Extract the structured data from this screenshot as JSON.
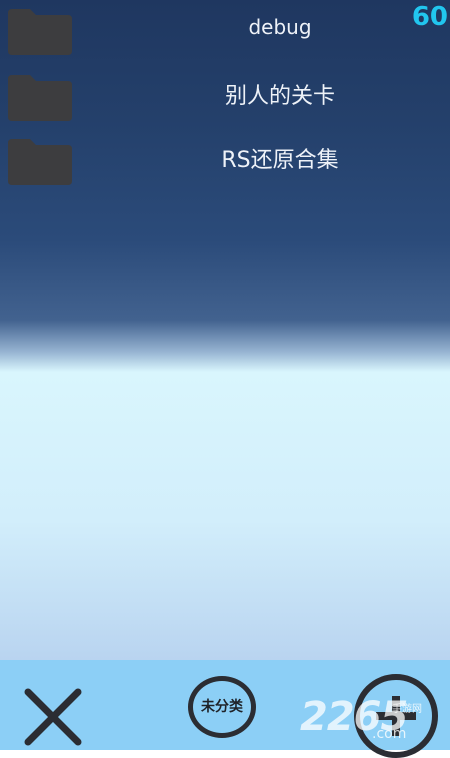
{
  "fps_counter": "60",
  "folders": [
    {
      "label": "debug",
      "icon": "folder-icon"
    },
    {
      "label": "别人的关卡",
      "icon": "folder-icon"
    },
    {
      "label": "RS还原合集",
      "icon": "folder-icon"
    }
  ],
  "toolbar": {
    "close_icon": "close-icon",
    "category_label": "未分类",
    "add_icon": "plus-icon"
  },
  "watermark": {
    "brand": "2265",
    "domain": ".com",
    "site": "手游网"
  },
  "colors": {
    "fps": "#21c6ef",
    "folder_icon": "#3d3d3f",
    "bottom_bar": "#8ccff6",
    "icon_dark": "#2b2d33"
  }
}
